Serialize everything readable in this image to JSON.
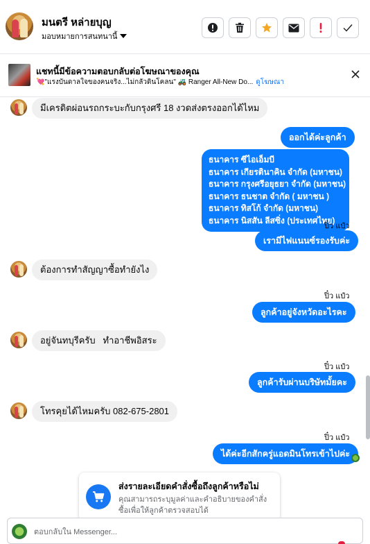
{
  "header": {
    "user_name": "มนตรี หล่ายบุญ",
    "assign_label": "มอบหมายการสนทนานี้",
    "actions": [
      {
        "name": "alert-button",
        "icon": "exclamation-circle-icon"
      },
      {
        "name": "delete-button",
        "icon": "trash-icon"
      },
      {
        "name": "star-button",
        "icon": "star-icon"
      },
      {
        "name": "mail-button",
        "icon": "envelope-icon"
      },
      {
        "name": "spam-button",
        "icon": "red-exclamation-icon",
        "label": "!"
      },
      {
        "name": "done-button",
        "icon": "checkmark-icon"
      }
    ],
    "colors": {
      "star": "#f5a623",
      "spam": "#e41e3f"
    }
  },
  "ad": {
    "title": "แชทนี้มีข้อความตอบกลับต่อโฆษณาของคุณ",
    "ad_text": "💘\"แรงบันดาลใจของคนจริง...ไม่กลัวดินโคลน\" 🚜 Ranger All-New Do...",
    "view_ad": "ดูโฆษณา"
  },
  "messages": [
    {
      "dir": "in",
      "text": "มีเครดิตผ่อนรถกระบะกับกรุงศรี 18 งวดส่งตรงออกได้ไหม"
    },
    {
      "dir": "out",
      "text": "ออกได้ค่ะลูกค้า"
    },
    {
      "dir": "out",
      "lines": [
        "ธนาคาร ซีไอเอ็มบี",
        "ธนาคาร เกียรตินาคิน จำกัด (มหาชน)",
        "ธนาคาร กรุงศรีอยุธยา จำกัด (มหาชน)",
        "ธนาคาร ธนชาต จำกัด ( มหาชน )",
        "ธนาคาร  ทิสโก้ จำกัด (มหาชน) ",
        "ธนาคาร  นิสสัน ลีสซิ่ง (ประเทศไทย)"
      ]
    },
    {
      "dir": "seen",
      "text": "ปิ๋ว แป๋ว"
    },
    {
      "dir": "out",
      "text": "เรามีไฟแนนซ์รองรับค่ะ"
    },
    {
      "dir": "in",
      "text": "ต้องการทำสัญญาซื้อทำยังไง"
    },
    {
      "dir": "seen",
      "text": "ปิ๋ว แป๋ว"
    },
    {
      "dir": "out",
      "text": "ลูกค้าอยู่จังหวัดอะไรคะ"
    },
    {
      "dir": "in",
      "text": "อยู่จันทบุรีครับ   ทำอาชีพอิสระ"
    },
    {
      "dir": "seen",
      "text": "ปิ๋ว แป๋ว"
    },
    {
      "dir": "out",
      "text": "ลูกค้ารับผ่านบริษัทมั้ยคะ"
    },
    {
      "dir": "in",
      "text": "โทรคุยได้ไหมครับ 082-675-2801"
    },
    {
      "dir": "seen",
      "text": "ปิ๋ว แป๋ว"
    },
    {
      "dir": "out",
      "text": "ได้ค่ะอีกสักครู่แอดมินโทรเข้าไปค่ะ"
    }
  ],
  "order_card": {
    "icon": "shopping-cart-icon",
    "title": "ส่งรายละเอียดคำสั่งซื้อถึงลูกค้าหรือไม่",
    "body": "คุณสามารถระบุมูลค่าและคำอธิบายของคำสั่งซื้อเพื่อให้ลูกค้าตรวจสอบได้"
  },
  "composer": {
    "placeholder": "ตอบกลับใน Messenger..."
  }
}
